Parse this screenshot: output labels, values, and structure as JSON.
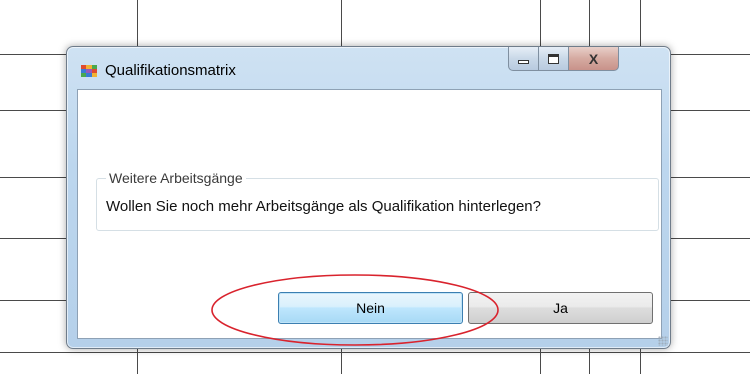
{
  "window": {
    "title": "Qualifikationsmatrix",
    "icon": "app-matrix-icon",
    "controls": {
      "minimize": "minimize-icon",
      "maximize": "maximize-icon",
      "close_glyph": "X"
    }
  },
  "dialog": {
    "group_label": "Weitere Arbeitsgänge",
    "message": "Wollen Sie noch mehr Arbeitsgänge als Qualifikation hinterlegen?"
  },
  "buttons": {
    "no_label": "Nein",
    "yes_label": "Ja"
  },
  "annotation": {
    "ellipse_color": "#d9232d",
    "highlights": "no-button"
  },
  "colors": {
    "window_frame": "#bcd6ee",
    "button_focus": "#bee6fd"
  }
}
